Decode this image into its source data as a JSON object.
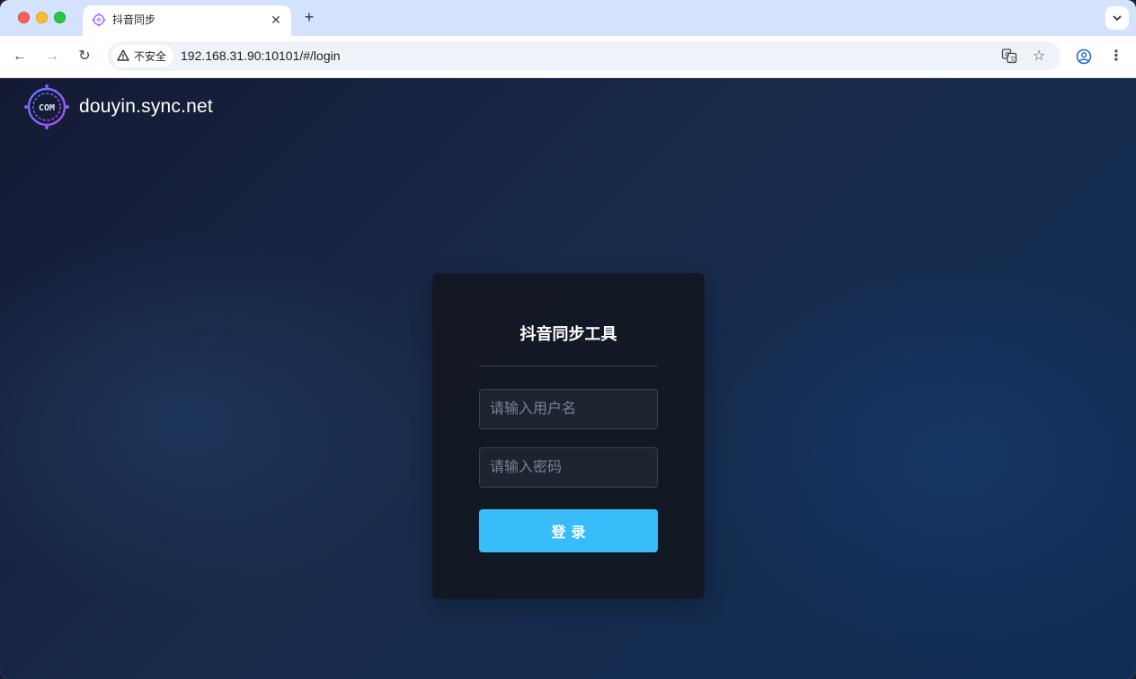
{
  "browser": {
    "tab": {
      "title": "抖音同步",
      "favicon": "douyin-sync-logo-icon",
      "close_glyph": "✕"
    },
    "new_tab_glyph": "+",
    "tab_search_glyph": "⌄",
    "nav": {
      "back_glyph": "←",
      "forward_glyph": "→",
      "reload_glyph": "↻"
    },
    "security_label": "不安全",
    "security_icon": "warning-triangle-icon",
    "url": "192.168.31.90:10101/#/login",
    "icons": [
      "translate-icon",
      "bookmark-star-icon",
      "profile-icon",
      "menu-dots-icon"
    ],
    "star_glyph": "☆",
    "menu_glyph": "⋮"
  },
  "site": {
    "name": "douyin.sync.net",
    "logo_text": "COM"
  },
  "login": {
    "title": "抖音同步工具",
    "username_placeholder": "请输入用户名",
    "password_placeholder": "请输入密码",
    "submit_label": "登录"
  },
  "colors": {
    "accent": "#38bdf8",
    "card_bg": "#131722",
    "page_bg": "#14233f",
    "logo": "#8b5cf6"
  }
}
